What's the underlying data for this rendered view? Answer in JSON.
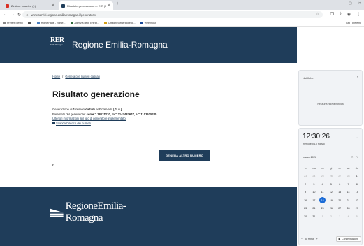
{
  "browser": {
    "tabs": [
      {
        "title": "Zimbra: In arrivo (1)",
        "active": false,
        "color": "#d93025"
      },
      {
        "title": "Risultato generazione — E-R | R...",
        "active": true,
        "color": "#1f3d5a"
      }
    ],
    "new_tab": "+",
    "window_controls": [
      "–",
      "▢",
      "✕"
    ],
    "url": "www.servizi.regione.emilia-romagna.it/generatore/",
    "bookmarks": [
      {
        "label": "Preferiti gestiti"
      },
      {
        "label": "Home Page - Rome..."
      },
      {
        "label": "Agenzia delle Entrat..."
      },
      {
        "label": "Cittadini/Generatore di..."
      },
      {
        "label": "Weebhost"
      }
    ],
    "all_bookmarks": "Tutti i preferiti"
  },
  "header": {
    "logo_mark": "RER",
    "logo_sub": "Emilia-Romagna",
    "title": "Regione Emilia-Romagna"
  },
  "breadcrumb": {
    "home": "Home",
    "sep": "/",
    "current": "Generatore numeri casuali"
  },
  "main": {
    "title": "Risultato generazione",
    "line1_a": "Generazione di ",
    "line1_b": "1",
    "line1_c": " numeri ",
    "line1_d": "distinti",
    "line1_e": " nell'intervallo ",
    "line1_f": "[ 1, 6 ]",
    "line2_a": "Parametri del generatore: ",
    "line2_b": "seme = 18031230",
    "line2_c": ", m = 2147483647, a = 1103515245",
    "more_info_link": "Ulteriori informazioni sul tipo di generatore implementato.",
    "download_link": "Scarica l'elenco dei numeri",
    "generate_button": "GENERA ALTRO NUMERO",
    "result": "6"
  },
  "footer": {
    "logo_text": "RegioneEmilia-Romagna"
  },
  "notifications": {
    "title": "Notifiche",
    "dnd": "z",
    "empty": "Nessuna nuova notifica"
  },
  "calendar": {
    "time": "12:30:26",
    "date": "mercoledì 18 marzo",
    "month": "marzo 2026",
    "weekdays": [
      "lu",
      "ma",
      "me",
      "gi",
      "ve",
      "sa",
      "do"
    ],
    "weeks": [
      [
        {
          "d": "23",
          "m": true
        },
        {
          "d": "24",
          "m": true
        },
        {
          "d": "25",
          "m": true
        },
        {
          "d": "26",
          "m": true
        },
        {
          "d": "27",
          "m": true
        },
        {
          "d": "28",
          "m": true
        },
        {
          "d": "1"
        }
      ],
      [
        {
          "d": "2"
        },
        {
          "d": "3"
        },
        {
          "d": "4"
        },
        {
          "d": "5"
        },
        {
          "d": "6"
        },
        {
          "d": "7"
        },
        {
          "d": "8"
        }
      ],
      [
        {
          "d": "9"
        },
        {
          "d": "10"
        },
        {
          "d": "11"
        },
        {
          "d": "12"
        },
        {
          "d": "13"
        },
        {
          "d": "14"
        },
        {
          "d": "15"
        }
      ],
      [
        {
          "d": "16"
        },
        {
          "d": "17"
        },
        {
          "d": "18",
          "t": true
        },
        {
          "d": "19"
        },
        {
          "d": "20"
        },
        {
          "d": "21"
        },
        {
          "d": "22"
        }
      ],
      [
        {
          "d": "23"
        },
        {
          "d": "24"
        },
        {
          "d": "25"
        },
        {
          "d": "26"
        },
        {
          "d": "27"
        },
        {
          "d": "28"
        },
        {
          "d": "29"
        }
      ],
      [
        {
          "d": "30"
        },
        {
          "d": "31"
        },
        {
          "d": "1",
          "m": true
        },
        {
          "d": "2",
          "m": true
        },
        {
          "d": "3",
          "m": true
        },
        {
          "d": "4",
          "m": true
        },
        {
          "d": "5",
          "m": true
        }
      ]
    ],
    "duration": "30 minuti",
    "focus_button": "Concentrazione"
  }
}
